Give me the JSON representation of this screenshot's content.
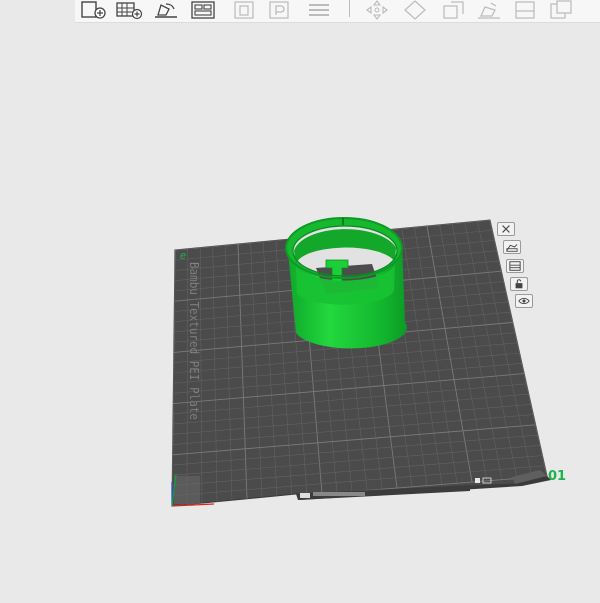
{
  "toolbar": {
    "buttons": [
      {
        "icon": "add-object-icon"
      },
      {
        "icon": "add-plate-icon"
      },
      {
        "icon": "auto-orient-icon"
      },
      {
        "icon": "arrange-icon"
      },
      {
        "icon": "split-objects-icon"
      },
      {
        "icon": "split-parts-icon"
      },
      {
        "icon": "layers-icon"
      },
      {
        "icon": "move-icon"
      },
      {
        "icon": "rotate-icon"
      },
      {
        "icon": "scale-icon"
      },
      {
        "icon": "lay-on-face-icon"
      },
      {
        "icon": "cut-icon"
      },
      {
        "icon": "support-paint-icon"
      }
    ]
  },
  "plate": {
    "number": "01",
    "corner_mark": "e",
    "bed_label": "Bambu Textured PEI Plate",
    "controls": [
      {
        "icon": "close-icon"
      },
      {
        "icon": "arrange-plate-icon"
      },
      {
        "icon": "plate-settings-icon"
      },
      {
        "icon": "lock-icon"
      },
      {
        "icon": "eye-icon"
      }
    ]
  },
  "model": {
    "color": "#19c631"
  },
  "colors": {
    "bed": "#4a4a4a",
    "grid": "#6c6c6c",
    "model": "#19c631",
    "accent": "#1db34a"
  }
}
